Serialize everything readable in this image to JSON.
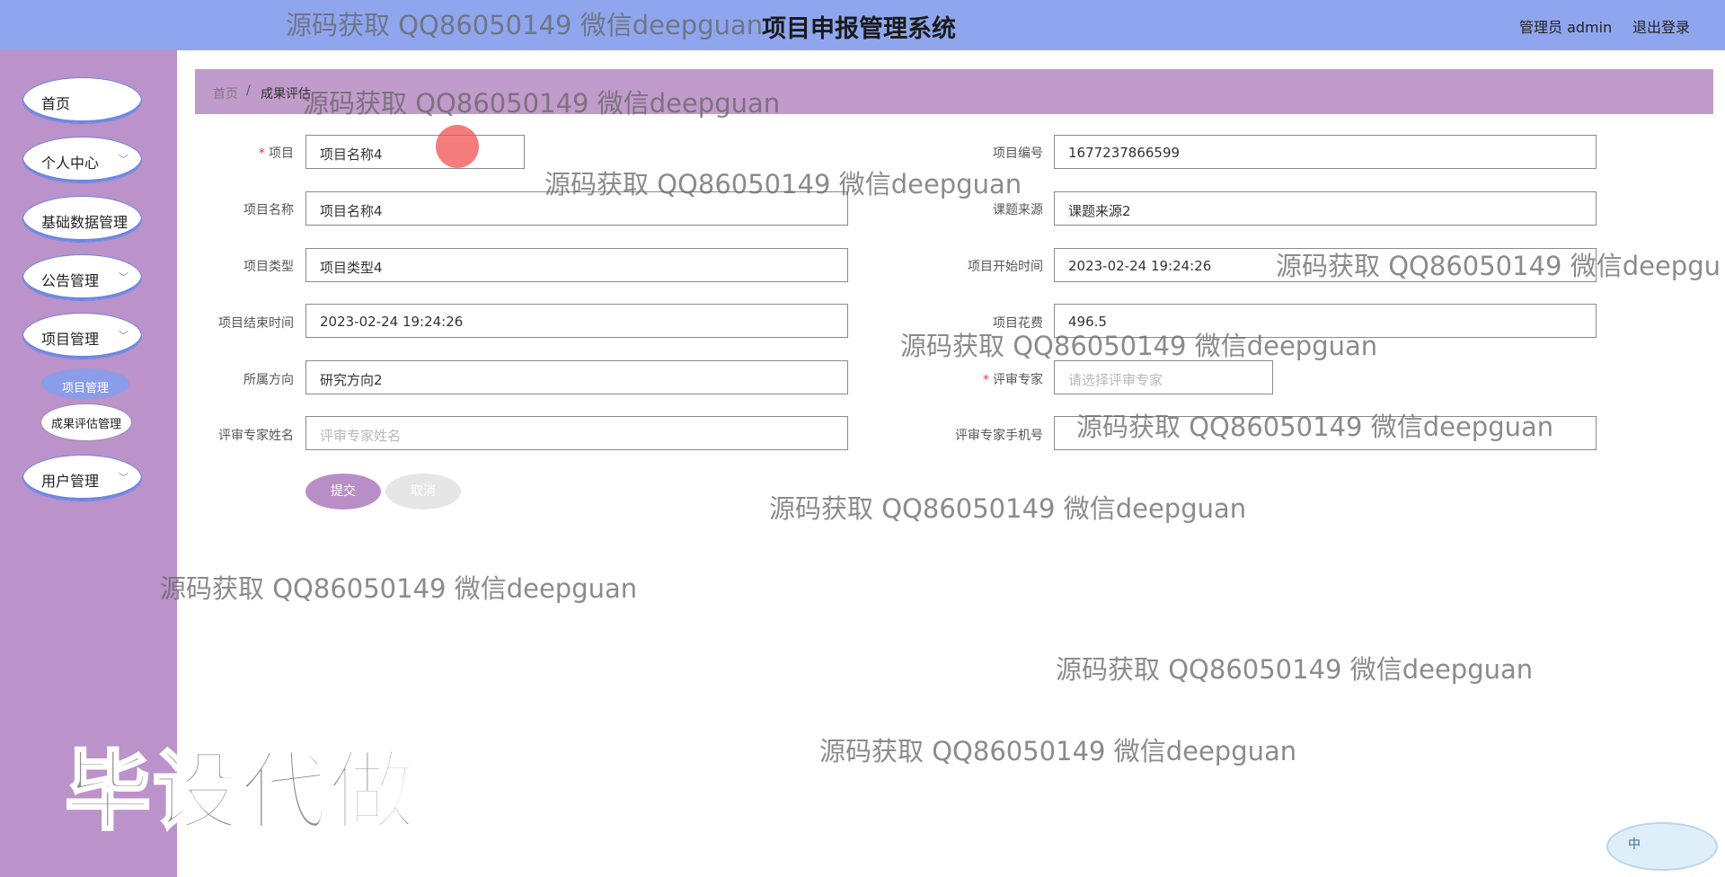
{
  "header": {
    "title": "项目申报管理系统",
    "user": "管理员 admin",
    "logout": "退出登录"
  },
  "sidebar": {
    "items": [
      {
        "label": "首页"
      },
      {
        "label": "个人中心",
        "chevron": "﹀"
      },
      {
        "label": "基础数据管理"
      },
      {
        "label": "公告管理",
        "chevron": "﹀"
      },
      {
        "label": "项目管理",
        "chevron": "﹀"
      },
      {
        "label": "用户管理",
        "chevron": "﹀"
      }
    ],
    "sub_items": [
      {
        "label": "项目管理",
        "active": true
      },
      {
        "label": "成果评估管理",
        "active": false
      }
    ]
  },
  "breadcrumb": {
    "home": "首页",
    "sep": "/",
    "current": "成果评估"
  },
  "form": {
    "project": {
      "label": "项目",
      "value": "项目名称4"
    },
    "project_no": {
      "label": "项目编号",
      "value": "1677237866599"
    },
    "project_name": {
      "label": "项目名称",
      "value": "项目名称4"
    },
    "topic_source": {
      "label": "课题来源",
      "value": "课题来源2"
    },
    "project_type": {
      "label": "项目类型",
      "value": "项目类型4"
    },
    "start_time": {
      "label": "项目开始时间",
      "value": "2023-02-24 19:24:26"
    },
    "end_time": {
      "label": "项目结束时间",
      "value": "2023-02-24 19:24:26"
    },
    "cost": {
      "label": "项目花费",
      "value": "496.5"
    },
    "direction": {
      "label": "所属方向",
      "value": "研究方向2"
    },
    "expert": {
      "label": "评审专家",
      "placeholder": "请选择评审专家"
    },
    "expert_name": {
      "label": "评审专家姓名",
      "placeholder": "评审专家姓名"
    },
    "expert_phone": {
      "label": "评审专家手机号",
      "placeholder": ""
    },
    "submit": "提交",
    "cancel": "取消"
  },
  "watermarks": {
    "text": "源码获取 QQ86050149 微信deepguan",
    "partial": "源码获取 QQ86050149 微信deepgu",
    "big": "毕设代做"
  },
  "ime": {
    "label": "中"
  },
  "colors": {
    "header": "#8fa6ee",
    "sidebar": "#bb92c9",
    "breadcrumb": "#c19bcb",
    "submit": "#b98ec6",
    "required": "#e03a3a"
  }
}
